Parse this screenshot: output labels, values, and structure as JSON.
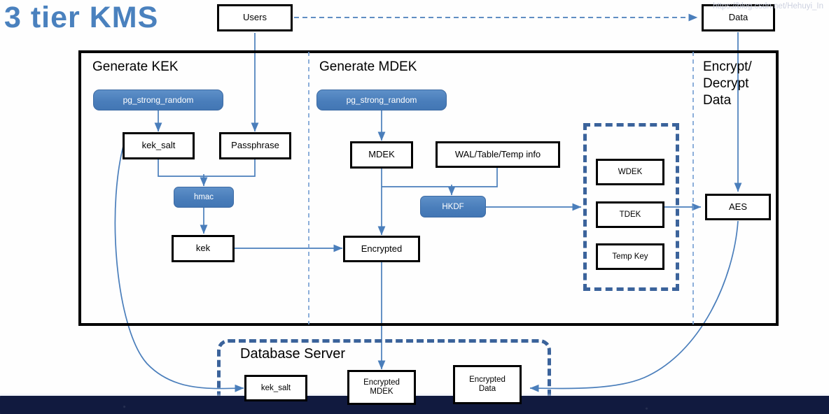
{
  "title": "3 tier KMS",
  "watermark": "https://blog.csdn.net/Hehuyi_In",
  "sections": {
    "generate_kek": "Generate KEK",
    "generate_mdek": "Generate MDEK",
    "encrypt_decrypt": "Encrypt/\nDecrypt\nData",
    "database_server": "Database Server"
  },
  "nodes": {
    "users": "Users",
    "data": "Data",
    "pg_strong_random_1": "pg_strong_random",
    "pg_strong_random_2": "pg_strong_random",
    "kek_salt": "kek_salt",
    "passphrase": "Passphrase",
    "hmac": "hmac",
    "kek": "kek",
    "mdek": "MDEK",
    "wal_table_temp_info": "WAL/Table/Temp info",
    "hkdf": "HKDF",
    "encrypted": "Encrypted",
    "wdek": "WDEK",
    "tdek": "TDEK",
    "temp_key": "Temp Key",
    "aes": "AES",
    "db_kek_salt": "kek_salt",
    "db_encrypted_mdek": "Encrypted\nMDEK",
    "db_encrypted_data": "Encrypted\nData"
  },
  "colors": {
    "accent_blue": "#4A81BE",
    "pill_blue": "#4A7EBB",
    "dashed_blue": "#3B639B",
    "connector_blue": "#4A7EBB",
    "node_border": "#000000",
    "navy_band": "#111a3f"
  },
  "chart_data": {
    "type": "diagram",
    "title": "3 tier KMS",
    "flows": [
      {
        "from": "Users",
        "to": "Data",
        "style": "dashed"
      },
      {
        "from": "Users",
        "to": "Passphrase",
        "style": "solid"
      },
      {
        "from": "pg_strong_random (KEK)",
        "to": "kek_salt",
        "style": "solid"
      },
      {
        "from": "kek_salt",
        "to": "hmac",
        "style": "solid"
      },
      {
        "from": "Passphrase",
        "to": "hmac",
        "style": "solid"
      },
      {
        "from": "hmac",
        "to": "kek",
        "style": "solid"
      },
      {
        "from": "kek",
        "to": "Encrypted",
        "style": "solid"
      },
      {
        "from": "kek_salt",
        "to": "kek_salt (Database Server)",
        "style": "curved"
      },
      {
        "from": "pg_strong_random (MDEK)",
        "to": "MDEK",
        "style": "solid"
      },
      {
        "from": "MDEK",
        "to": "Encrypted",
        "style": "solid"
      },
      {
        "from": "MDEK",
        "to": "HKDF",
        "style": "solid"
      },
      {
        "from": "WAL/Table/Temp info",
        "to": "HKDF",
        "style": "solid"
      },
      {
        "from": "HKDF",
        "to": "Key set (WDEK/TDEK/Temp Key)",
        "style": "solid"
      },
      {
        "from": "Encrypted",
        "to": "Encrypted MDEK",
        "style": "solid"
      },
      {
        "from": "TDEK",
        "to": "AES",
        "style": "solid"
      },
      {
        "from": "Data",
        "to": "AES",
        "style": "solid"
      },
      {
        "from": "AES",
        "to": "Encrypted Data",
        "style": "curved"
      }
    ]
  }
}
